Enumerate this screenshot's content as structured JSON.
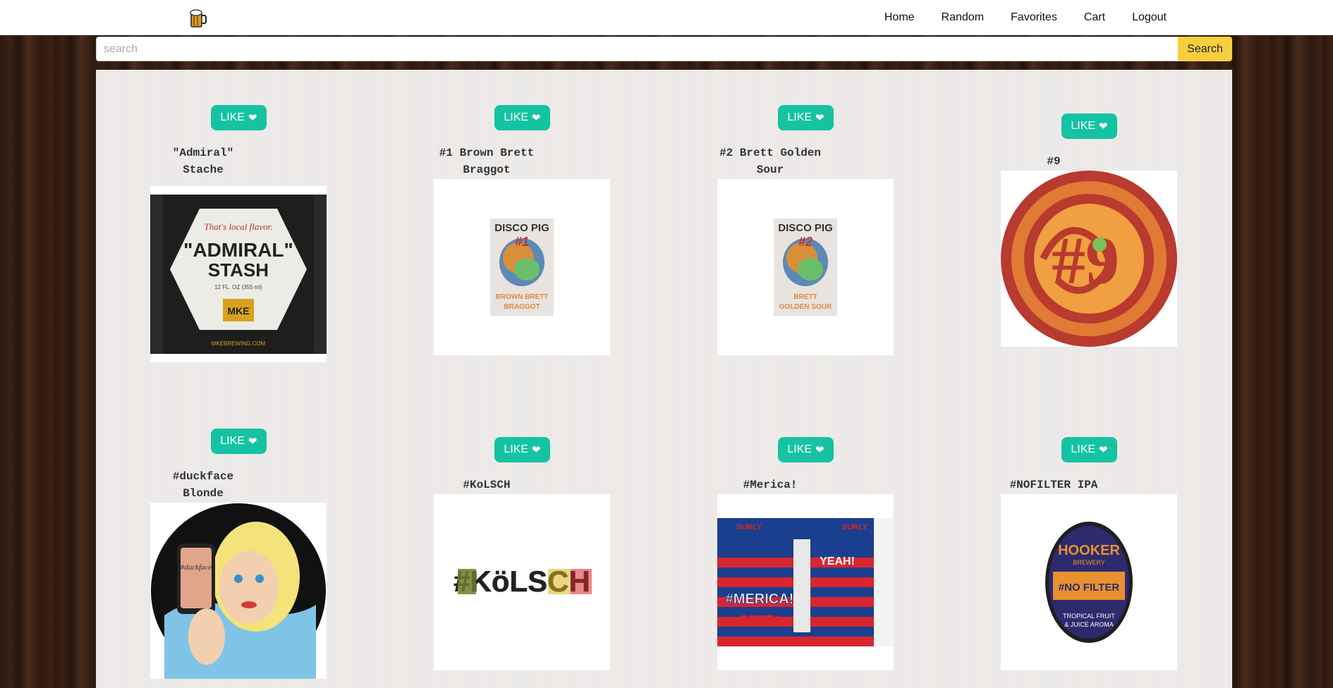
{
  "nav": {
    "logo_icon": "beer-mug-icon",
    "links": [
      "Home",
      "Random",
      "Favorites",
      "Cart",
      "Logout"
    ]
  },
  "search": {
    "placeholder": "search",
    "value": "",
    "button_label": "Search"
  },
  "like_label": "LIKE",
  "like_icon": "heart-icon",
  "colors": {
    "accent": "#15c3a3",
    "search_button": "#f7ce3e"
  },
  "beers": [
    {
      "name": "\"Admiral\"\nStache",
      "label_text": [
        "That's local flavor.",
        "\"ADMIRAL\"",
        "STASH",
        "12 FL. OZ (355 ml)",
        "MKE",
        "MKEBREWING.COM"
      ]
    },
    {
      "name": "#1 Brown Brett\nBraggot",
      "label_text": [
        "DISCO PIG",
        "#1",
        "BROWN BRETT",
        "BRAGGOT"
      ]
    },
    {
      "name": "#2 Brett Golden\nSour",
      "label_text": [
        "DISCO PIG",
        "#2",
        "BRETT",
        "GOLDEN SOUR"
      ]
    },
    {
      "name": "#9",
      "label_text": [
        "#9"
      ]
    },
    {
      "name": "#duckface\nBlonde",
      "label_text": [
        "#duckface"
      ]
    },
    {
      "name": "#KoLSCH",
      "label_text": [
        "#KöLSCH"
      ]
    },
    {
      "name": "#Merica!",
      "label_text": [
        "SURLY",
        "SURLY",
        "#MERICA!",
        "BEER!",
        "YEAH!"
      ]
    },
    {
      "name": "#NOFILTER IPA",
      "label_text": [
        "HOOKER",
        "BREWERY",
        "#NO FILTER",
        "TROPICAL FRUIT",
        "& JUICE AROMA"
      ]
    }
  ]
}
